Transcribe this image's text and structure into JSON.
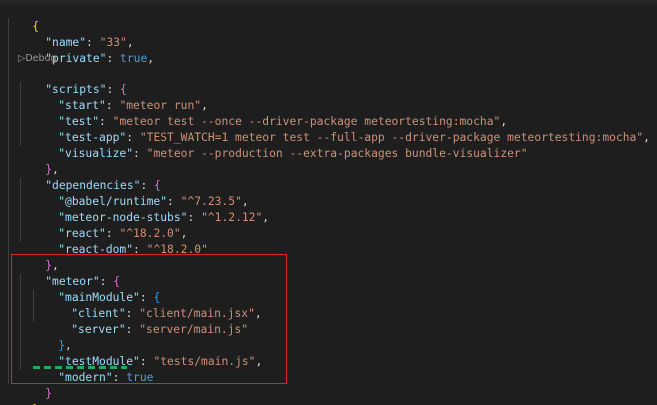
{
  "codelens": {
    "debug": "Debug",
    "debug_icon": "play-triangle-icon"
  },
  "lines": {
    "l0": {
      "brace": "{"
    },
    "l1": {
      "key": "\"name\"",
      "colon": ": ",
      "value": "\"33\"",
      "comma": ","
    },
    "l2": {
      "key": "\"private\"",
      "colon": ": ",
      "value": "true",
      "comma": ","
    },
    "l3": {
      "key": "\"scripts\"",
      "colon": ": ",
      "brace": "{"
    },
    "l4": {
      "key": "\"start\"",
      "colon": ": ",
      "value": "\"meteor run\"",
      "comma": ","
    },
    "l5": {
      "key": "\"test\"",
      "colon": ": ",
      "value": "\"meteor test --once --driver-package meteortesting:mocha\"",
      "comma": ","
    },
    "l6": {
      "key": "\"test-app\"",
      "colon": ": ",
      "value": "\"TEST_WATCH=1 meteor test --full-app --driver-package meteortesting:mocha\"",
      "comma": ","
    },
    "l7": {
      "key": "\"visualize\"",
      "colon": ": ",
      "value": "\"meteor --production --extra-packages bundle-visualizer\""
    },
    "l8": {
      "brace": "}",
      "comma": ","
    },
    "l9": {
      "key": "\"dependencies\"",
      "colon": ": ",
      "brace": "{"
    },
    "l10": {
      "key": "\"@babel/runtime\"",
      "colon": ": ",
      "value": "\"^7.23.5\"",
      "comma": ","
    },
    "l11": {
      "key": "\"meteor-node-stubs\"",
      "colon": ": ",
      "value": "\"^1.2.12\"",
      "comma": ","
    },
    "l12": {
      "key": "\"react\"",
      "colon": ": ",
      "value": "\"^18.2.0\"",
      "comma": ","
    },
    "l13": {
      "key": "\"react-dom\"",
      "colon": ": ",
      "value": "\"^18.2.0\""
    },
    "l14": {
      "brace": "}",
      "comma": ","
    },
    "l15": {
      "key": "\"meteor\"",
      "colon": ": ",
      "brace": "{"
    },
    "l16": {
      "key": "\"mainModule\"",
      "colon": ": ",
      "brace": "{"
    },
    "l17": {
      "key": "\"client\"",
      "colon": ": ",
      "value": "\"client/main.jsx\"",
      "comma": ","
    },
    "l18": {
      "key": "\"server\"",
      "colon": ": ",
      "value": "\"server/main.js\""
    },
    "l19": {
      "brace": "}",
      "comma": ","
    },
    "l20": {
      "key": "\"testModule\"",
      "colon": ": ",
      "value": "\"tests/main.js\"",
      "comma": ","
    },
    "l21": {
      "key": "\"modern\"",
      "colon": ": ",
      "value": "true"
    },
    "l22": {
      "brace": "}"
    },
    "l23": {
      "brace": "}"
    }
  },
  "colors": {
    "background": "#1e1e1e",
    "key": "#9cdcfe",
    "string": "#ce9178",
    "boolean": "#569cd6",
    "highlight_box": "#e0202a",
    "squiggle": "#23a95f"
  }
}
